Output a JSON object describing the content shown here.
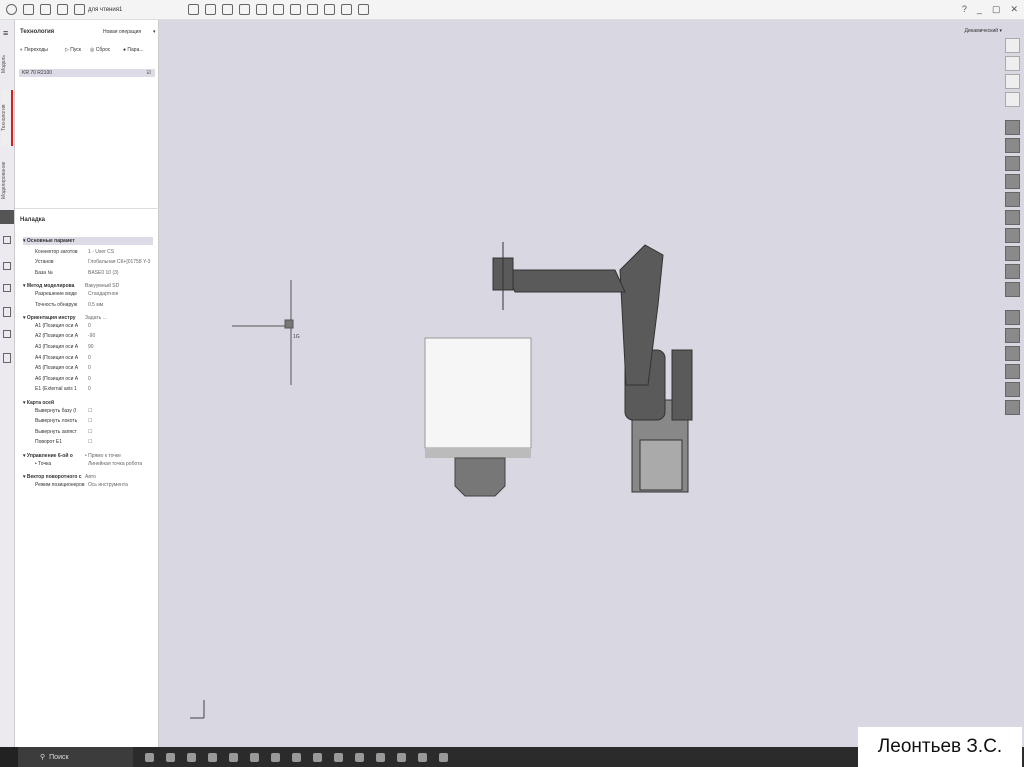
{
  "topbar": {
    "doc_title": "для чтения1",
    "help": "?",
    "minimize": "_",
    "restore": "▢",
    "close": "✕"
  },
  "sidebar_tabs": [
    "Модель",
    "Технология",
    "Моделирование"
  ],
  "panel": {
    "title": "Технология",
    "new_op": "Новая операция",
    "toolbar": [
      "Переходы",
      "Пуск",
      "Сброс",
      "Пара..."
    ],
    "tree_item": "KR 70 R2100",
    "setup_title": "Наладка",
    "rows": [
      {
        "t": "Основные парамет",
        "v": "",
        "lvl": 0,
        "hdr": true
      },
      {
        "t": "Коннектор заготов",
        "v": "1 - User CS",
        "lvl": 1
      },
      {
        "t": "Установ",
        "v": "Глобальная СК+[01758 Y-3",
        "lvl": 1
      },
      {
        "t": "База №",
        "v": "BASE0 10 (3)",
        "lvl": 1
      },
      {
        "t": "Метод моделирова",
        "v": "Вакуумный SD",
        "lvl": 0,
        "hdr": true
      },
      {
        "t": "Разрешение моде",
        "v": "Стандартное",
        "lvl": 1
      },
      {
        "t": "Точность обнаруж",
        "v": "0.5 мм",
        "lvl": 1
      },
      {
        "t": "Ориентация инстру",
        "v": "Задать ...",
        "lvl": 0,
        "hdr": true
      },
      {
        "t": "A1 (Позиция оси А",
        "v": "0",
        "lvl": 1
      },
      {
        "t": "A2 (Позиция оси А",
        "v": "-90",
        "lvl": 1
      },
      {
        "t": "A3 (Позиция оси А",
        "v": "90",
        "lvl": 1
      },
      {
        "t": "A4 (Позиция оси А",
        "v": "0",
        "lvl": 1
      },
      {
        "t": "A5 (Позиция оси А",
        "v": "0",
        "lvl": 1
      },
      {
        "t": "A6 (Позиция оси А",
        "v": "0",
        "lvl": 1
      },
      {
        "t": "E1 (External axis 1",
        "v": "0",
        "lvl": 1
      },
      {
        "t": "Карта осей",
        "v": "",
        "lvl": 0,
        "hdr": true
      },
      {
        "t": "Вывернуть базу (I",
        "v": "☐",
        "lvl": 1
      },
      {
        "t": "Вывернуть локоть",
        "v": "☐",
        "lvl": 1
      },
      {
        "t": "Вывернуть запяст",
        "v": "☐",
        "lvl": 1
      },
      {
        "t": "Поворот E1",
        "v": "☐",
        "lvl": 1
      },
      {
        "t": "Управление 6-ой о",
        "v": "• Прямо к точке",
        "lvl": 0,
        "hdr": true
      },
      {
        "t": "• Точка",
        "v": "Линейная точка робота",
        "lvl": 1
      },
      {
        "t": "Вектор поворотного с",
        "v": "Авто",
        "lvl": 0,
        "hdr": true
      },
      {
        "t": "Режим позиционеров",
        "v": "Ось инструмента",
        "lvl": 1
      }
    ]
  },
  "viewport": {
    "view_mode": "Динамический",
    "axis_label": "1G"
  },
  "taskbar": {
    "search": "Поиск"
  },
  "author": "Леонтьев З.С."
}
